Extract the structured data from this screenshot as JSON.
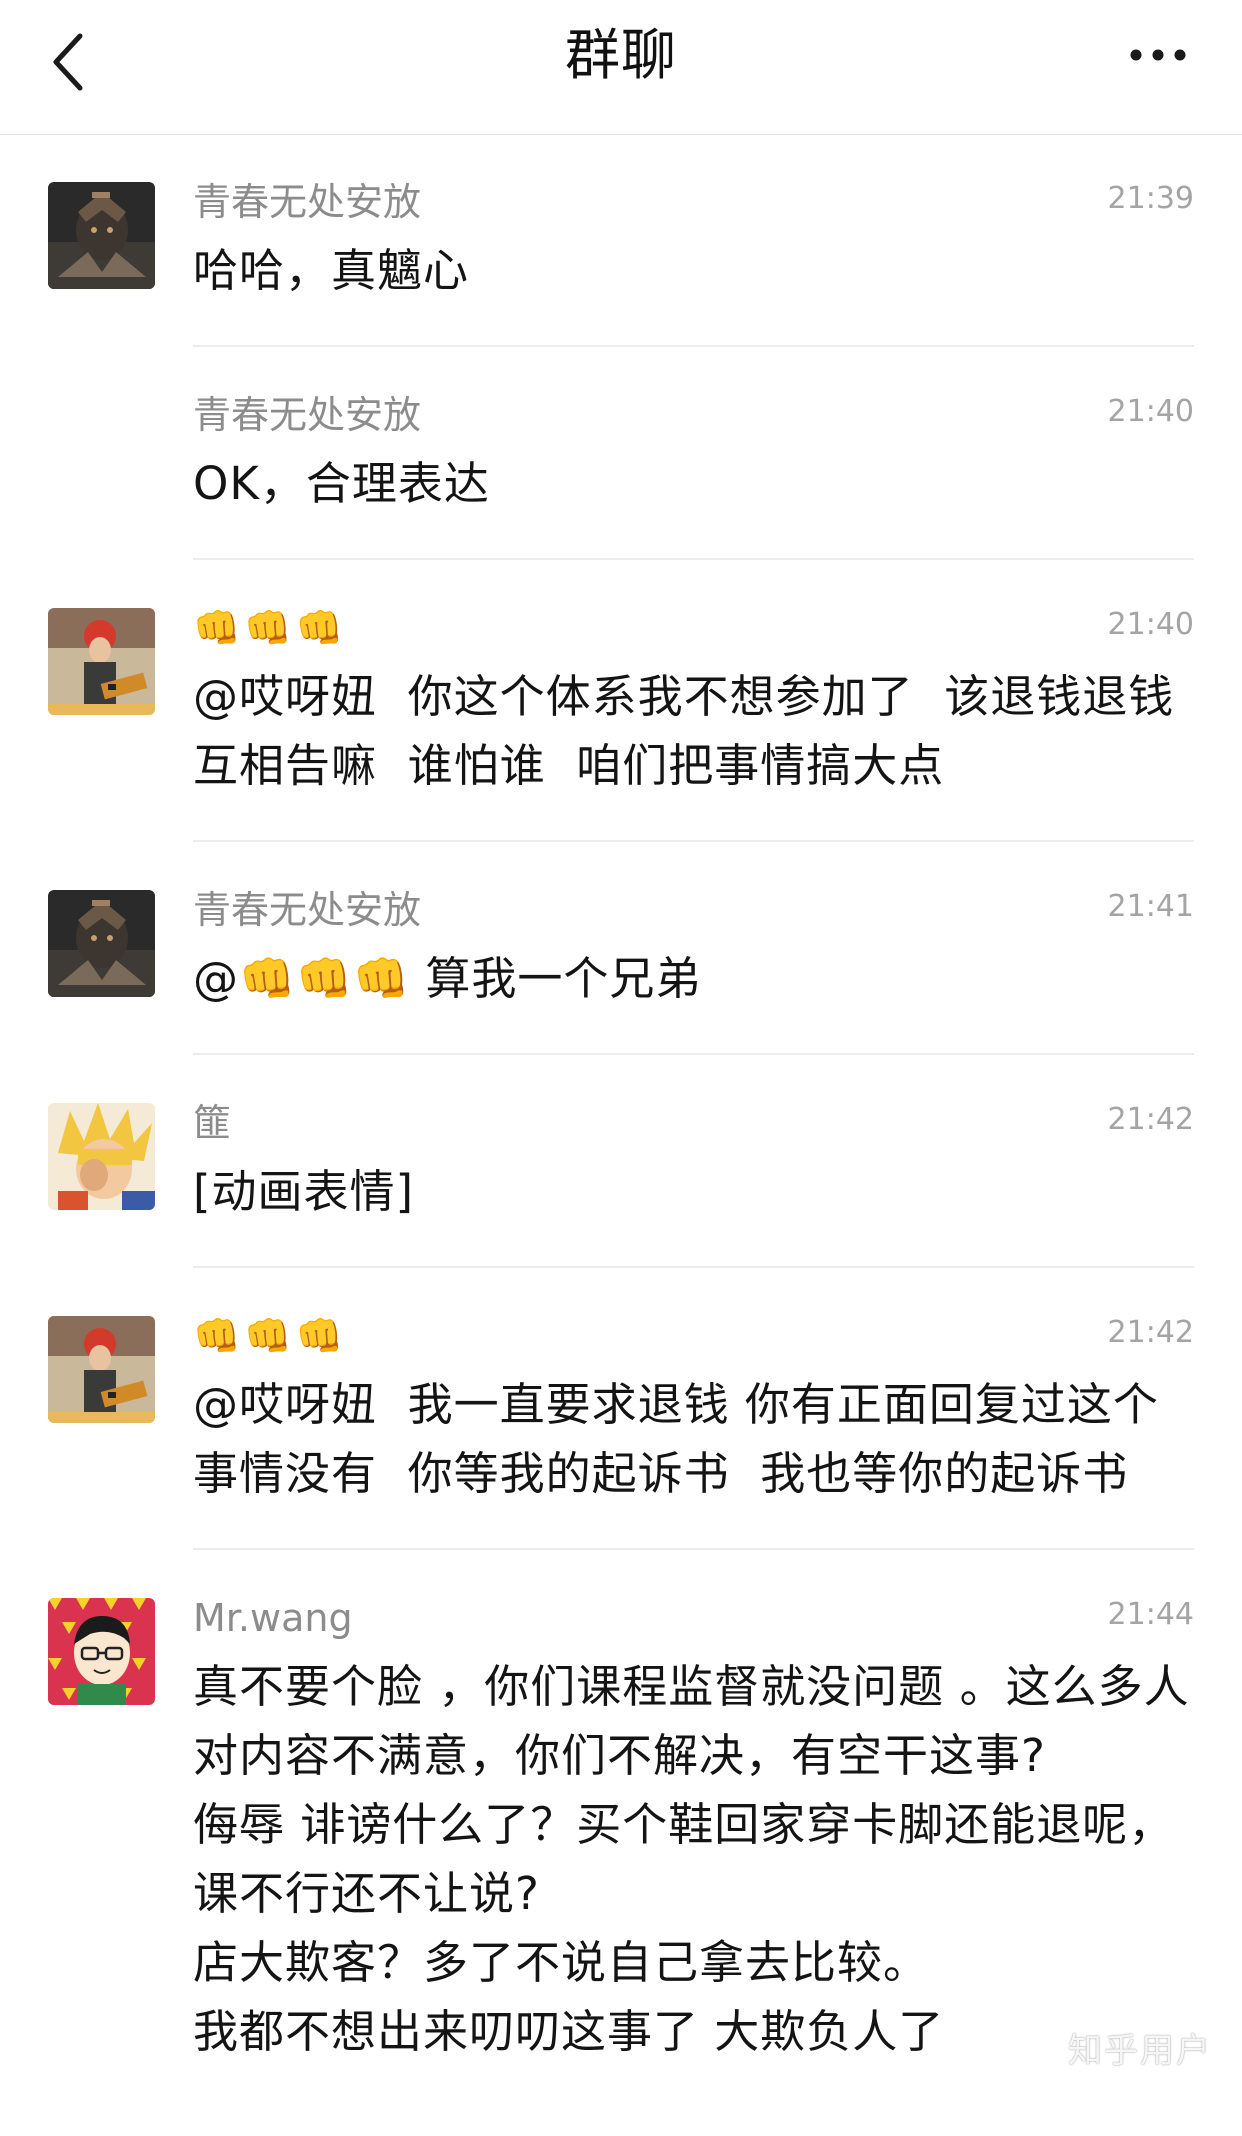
{
  "nav": {
    "title": "群聊",
    "back_icon": "chevron-left-icon",
    "more_icon": "more-horizontal-icon"
  },
  "messages": [
    {
      "sender": "青春无处安放",
      "time": "21:39",
      "text": "哈哈，真魑心",
      "avatar": "dark-armored-warrior",
      "show_avatar": true
    },
    {
      "sender": "青春无处安放",
      "time": "21:40",
      "text": "OK，合理表达",
      "avatar": "",
      "show_avatar": false
    },
    {
      "sender": "👊👊👊",
      "time": "21:40",
      "text": "@哎呀妞  你这个体系我不想参加了  该退钱退钱  互相告嘛  谁怕谁  咱们把事情搞大点",
      "avatar": "guitar-player",
      "show_avatar": true
    },
    {
      "sender": "青春无处安放",
      "time": "21:41",
      "text": "@👊👊👊 算我一个兄弟",
      "avatar": "dark-armored-warrior",
      "show_avatar": true
    },
    {
      "sender": "篚",
      "time": "21:42",
      "text": "[动画表情]",
      "avatar": "blonde-anime-hero",
      "show_avatar": true
    },
    {
      "sender": "👊👊👊",
      "time": "21:42",
      "text": "@哎呀妞  我一直要求退钱 你有正面回复过这个事情没有  你等我的起诉书  我也等你的起诉书",
      "avatar": "guitar-player",
      "show_avatar": true
    },
    {
      "sender": "Mr.wang",
      "time": "21:44",
      "text": "真不要个脸 ，你们课程监督就没问题 。这么多人对内容不满意，你们不解决，有空干这事?\n侮辱 诽谤什么了？买个鞋回家穿卡脚还能退呢，课不行还不让说?\n店大欺客？多了不说自己拿去比较。\n我都不想出来叨叨这事了 大欺负人了",
      "avatar": "cartoon-glasses-man",
      "show_avatar": true
    }
  ],
  "watermark": "知乎用户",
  "colors": {
    "time": "#a4a4a4",
    "sender": "#8c8c8c",
    "divider": "#ececec"
  }
}
